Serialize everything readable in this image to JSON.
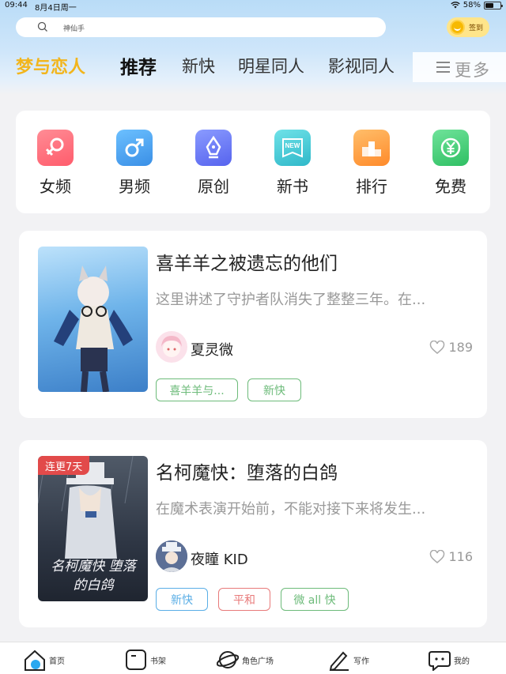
{
  "status_bar": {
    "time": "09:44",
    "date": "8月4日周一",
    "battery": "58%",
    "battery_level": 0.58
  },
  "search": {
    "placeholder": "神仙手"
  },
  "checkin": {
    "label": "签到"
  },
  "tabs": [
    {
      "label": "梦与恋人"
    },
    {
      "label": "推荐"
    },
    {
      "label": "新快"
    },
    {
      "label": "明星同人"
    },
    {
      "label": "影视同人"
    }
  ],
  "more": {
    "label": "更多"
  },
  "categories": [
    {
      "label": "女频",
      "icon": "female-icon",
      "color": "#ff6b78"
    },
    {
      "label": "男频",
      "icon": "male-icon",
      "color": "#4aa3ee"
    },
    {
      "label": "原创",
      "icon": "pen-nib-icon",
      "color": "#6a78f5"
    },
    {
      "label": "新书",
      "icon": "new-book-icon",
      "color": "#3fc9d6"
    },
    {
      "label": "排行",
      "icon": "podium-icon",
      "color": "#ffa23f"
    },
    {
      "label": "免费",
      "icon": "yen-coin-icon",
      "color": "#3ecf7a"
    }
  ],
  "books": [
    {
      "title": "喜羊羊之被遗忘的他们",
      "description": "这里讲述了守护者队消失了整整三年。在...",
      "author": "夏灵微",
      "likes": "189",
      "ribbon": "",
      "tags": [
        {
          "label": "喜羊羊与...",
          "color": "#6dbb7a"
        },
        {
          "label": "新快",
          "color": "#6dbb7a"
        }
      ]
    },
    {
      "title": "名柯魔快：堕落的白鸽",
      "description": "在魔术表演开始前，不能对接下来将发生...",
      "author": "夜瞳 KID",
      "likes": "116",
      "ribbon": "连更7天",
      "cover_text": "名柯魔快 堕落的白鸽",
      "tags": [
        {
          "label": "新快",
          "color": "#5aaee6"
        },
        {
          "label": "平和",
          "color": "#e87a7a"
        },
        {
          "label": "微 all 快",
          "color": "#6dbb7a"
        }
      ]
    }
  ],
  "tabbar": [
    {
      "label": "首页",
      "icon": "home-icon"
    },
    {
      "label": "书架",
      "icon": "bookshelf-icon"
    },
    {
      "label": "角色广场",
      "icon": "planet-icon"
    },
    {
      "label": "写作",
      "icon": "pencil-icon"
    },
    {
      "label": "我的",
      "icon": "chat-profile-icon"
    }
  ]
}
